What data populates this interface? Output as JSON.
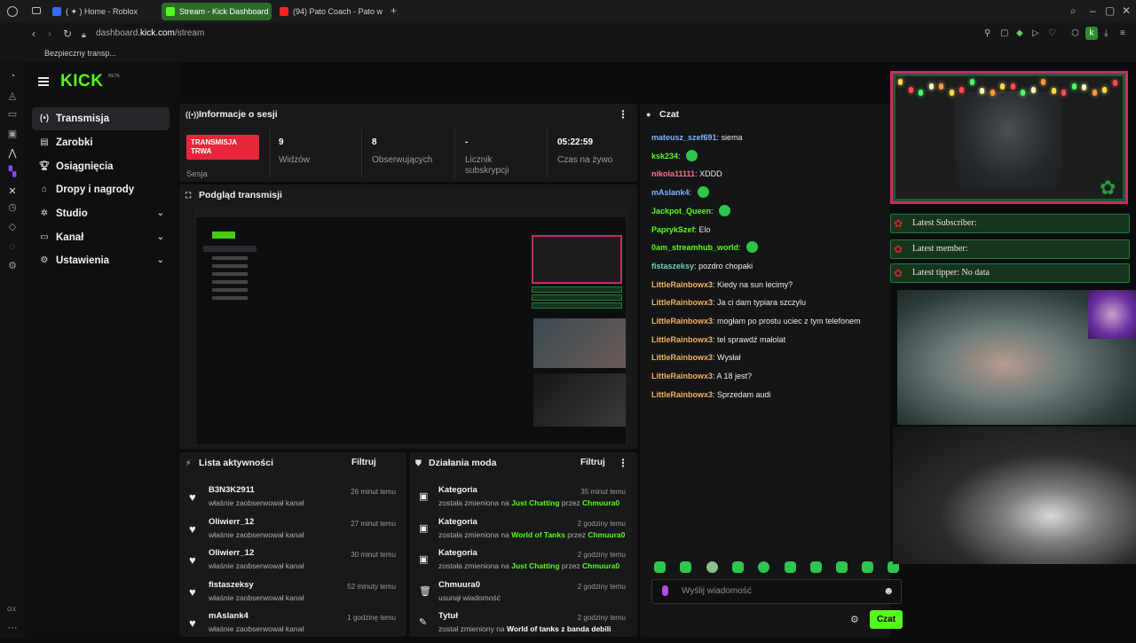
{
  "browser": {
    "tabs": [
      {
        "label": "( ✦ ) Home - Roblox",
        "color": "#3a6bff"
      },
      {
        "label": "Stream - Kick Dashboard",
        "color": "#53fc18",
        "active": true
      },
      {
        "label": "(94) Pato Coach - Pato w",
        "color": "#ff2222"
      }
    ],
    "url_host": "dashboard.kick.com",
    "url_path": "/stream",
    "url_prefix": "dashboard.",
    "url_domain": "kick.com",
    "secure_label": "Bezpieczny transp...",
    "profile_letter": "k",
    "corner_label": "GX"
  },
  "kick": {
    "logo": "KICK",
    "logo_tag": "BETA",
    "nav": [
      {
        "label": "Transmisja",
        "icon": "broadcast-icon",
        "active": true
      },
      {
        "label": "Zarobki",
        "icon": "earnings-icon"
      },
      {
        "label": "Osiągnięcia",
        "icon": "trophy-icon"
      },
      {
        "label": "Dropy i nagrody",
        "icon": "gift-icon"
      },
      {
        "label": "Studio",
        "icon": "gear-icon",
        "expandable": true
      },
      {
        "label": "Kanał",
        "icon": "tv-icon",
        "expandable": true
      },
      {
        "label": "Ustawienia",
        "icon": "settings-icon",
        "expandable": true
      }
    ]
  },
  "session": {
    "title": "Informacje o sesji",
    "live_badge": "TRANSMISJA TRWA",
    "session_label": "Sesja",
    "stats": [
      {
        "value": "9",
        "label": "Widzów"
      },
      {
        "value": "8",
        "label": "Obserwujących"
      },
      {
        "value": "-",
        "label": "Licznik subskrypcji"
      },
      {
        "value": "05:22:59",
        "label": "Czas na żywo"
      }
    ]
  },
  "preview": {
    "title": "Podgląd transmisji"
  },
  "activity": {
    "title": "Lista aktywności",
    "filter_label": "Filtruj",
    "items": [
      {
        "name": "B3N3K2911",
        "action": "właśnie zaobserwował kanał",
        "time": "26 minut temu"
      },
      {
        "name": "Oliwierr_12",
        "action": "właśnie zaobserwował kanał",
        "time": "27 minut temu"
      },
      {
        "name": "Oliwierr_12",
        "action": "właśnie zaobserwował kanał",
        "time": "30 minut temu"
      },
      {
        "name": "fistaszeksy",
        "action": "właśnie zaobserwował kanał",
        "time": "52 minuty temu"
      },
      {
        "name": "mAslank4",
        "action": "właśnie zaobserwował kanał",
        "time": "1 godzinę temu"
      }
    ]
  },
  "mod": {
    "title": "Działania moda",
    "filter_label": "Filtruj",
    "items": [
      {
        "name": "Kategoria",
        "pre": "została zmieniona na ",
        "hl1": "Just Chatting",
        "mid": " przez ",
        "hl2": "Chmuura0",
        "time": "35 minut temu"
      },
      {
        "name": "Kategoria",
        "pre": "została zmieniona na ",
        "hl1": "World of Tanks",
        "mid": " przez ",
        "hl2": "Chmuura0",
        "time": "2 godziny temu"
      },
      {
        "name": "Kategoria",
        "pre": "została zmieniona na ",
        "hl1": "Just Chatting",
        "mid": " przez ",
        "hl2": "Chmuura0",
        "time": "2 godziny temu"
      },
      {
        "name": "Chmuura0",
        "pre": "usunął wiadomość",
        "hl1": "",
        "mid": "",
        "hl2": "",
        "time": "2 godziny temu"
      },
      {
        "name": "Tytuł",
        "pre": "został zmieniony na ",
        "hl1": "",
        "mid": "",
        "hl2": "",
        "bold_tail": "World of tanks z banda debili",
        "time": "2 godziny temu"
      }
    ]
  },
  "chat": {
    "title": "Czat",
    "messages": [
      {
        "user": "mateusz_szef691",
        "color": "#7fb3ff",
        "text": "siema"
      },
      {
        "user": "ksk234",
        "color": "#53fc18",
        "text": "",
        "emote": true
      },
      {
        "user": "nikola11111",
        "color": "#ff6f91",
        "text": "XDDD"
      },
      {
        "user": "mAslank4",
        "color": "#7fb3ff",
        "text": "",
        "emote": true
      },
      {
        "user": "Jackpot_Queen",
        "color": "#53fc18",
        "text": "",
        "emote": true
      },
      {
        "user": "PaprykSzef",
        "color": "#53fc18",
        "text": "Elo"
      },
      {
        "user": "0am_streamhub_world",
        "color": "#53fc18",
        "text": "",
        "emote": true
      },
      {
        "user": "fistaszeksy",
        "color": "#6fd0c0",
        "text": "pozdro chopaki"
      },
      {
        "user": "LittleRainbowx3",
        "color": "#f0b060",
        "text": "Kiedy na sun lecimy?"
      },
      {
        "user": "LittleRainbowx3",
        "color": "#f0b060",
        "text": "Ja ci dam typiara szczylu"
      },
      {
        "user": "LittleRainbowx3",
        "color": "#f0b060",
        "text": "mogłam po prostu uciec z tym telefonem"
      },
      {
        "user": "LittleRainbowx3",
        "color": "#f0b060",
        "text": "tel sprawdź małolat"
      },
      {
        "user": "LittleRainbowx3",
        "color": "#f0b060",
        "text": "Wysłał"
      },
      {
        "user": "LittleRainbowx3",
        "color": "#f0b060",
        "text": "A 18 jest?"
      },
      {
        "user": "LittleRainbowx3",
        "color": "#f0b060",
        "text": "Sprzedam audi"
      }
    ],
    "input_placeholder": "Wyślij wiadomość",
    "send_label": "Czat"
  },
  "overlay": {
    "latest_subscriber": "Latest Subscriber:",
    "latest_member": "Latest member:",
    "latest_tipper": "Latest tipper: No data"
  }
}
